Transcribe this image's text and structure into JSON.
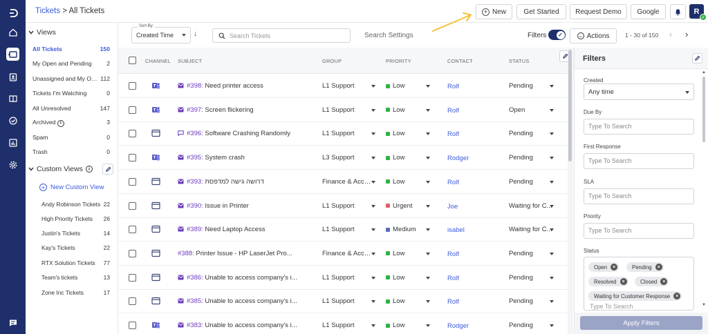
{
  "breadcrumb": {
    "parent": "Tickets",
    "separator": " > ",
    "current": "All Tickets"
  },
  "header_buttons": {
    "new": "New",
    "get_started": "Get Started",
    "request_demo": "Request Demo",
    "google": "Google"
  },
  "avatar": {
    "initial": "R",
    "status_color": "#2fb344"
  },
  "views": {
    "title": "Views",
    "items": [
      {
        "label": "All Tickets",
        "count": "150"
      },
      {
        "label": "My Open and Pending",
        "count": "2"
      },
      {
        "label": "Unassigned and My Op...",
        "count": "112"
      },
      {
        "label": "Tickets I'm Watching",
        "count": "0"
      },
      {
        "label": "All Unresolved",
        "count": "147"
      },
      {
        "label": "Archived",
        "count": "3"
      },
      {
        "label": "Spam",
        "count": "0"
      },
      {
        "label": "Trash",
        "count": "0"
      }
    ]
  },
  "custom_views": {
    "title": "Custom Views",
    "new_label": "New Custom View",
    "items": [
      {
        "label": "Andy Robinson Tickets",
        "count": "22"
      },
      {
        "label": "High Priority Tickets",
        "count": "26"
      },
      {
        "label": "Justin's Tickets",
        "count": "14"
      },
      {
        "label": "Kay's Tickets",
        "count": "22"
      },
      {
        "label": "RTX Solution Tickets",
        "count": "77"
      },
      {
        "label": "Team's tickets",
        "count": "13"
      },
      {
        "label": "Zone Inc Tickets",
        "count": "17"
      }
    ]
  },
  "toolbar": {
    "sort_label": "Sort By:",
    "sort_value": "Created Time",
    "search_placeholder": "Search Tickets",
    "search_settings": "Search Settings",
    "filters_label": "Filters",
    "actions_label": "Actions",
    "pagination": "1 - 30 of 150"
  },
  "table": {
    "columns": {
      "channel": "CHANNEL",
      "subject": "SUBJECT",
      "group": "GROUP",
      "priority": "PRIORITY",
      "contact": "CONTACT",
      "status": "STATUS"
    },
    "rows": [
      {
        "channel": "teams",
        "subject_icon": "email",
        "number": "#398:",
        "subject": "Need printer access",
        "group": "L1 Support",
        "priority": "Low",
        "contact": "Rolf",
        "status": "Pending"
      },
      {
        "channel": "teams",
        "subject_icon": "email",
        "number": "#397:",
        "subject": "Screen flickering",
        "group": "L1 Support",
        "priority": "Low",
        "contact": "Rolf",
        "status": "Open"
      },
      {
        "channel": "portal",
        "subject_icon": "chat",
        "number": "#396:",
        "subject": "Software Crashing Randomly",
        "group": "L1 Support",
        "priority": "Low",
        "contact": "Rolf",
        "status": "Pending"
      },
      {
        "channel": "teams",
        "subject_icon": "email",
        "number": "#395:",
        "subject": "System crash",
        "group": "L3 Support",
        "priority": "Low",
        "contact": "Rodger",
        "status": "Pending"
      },
      {
        "channel": "portal",
        "subject_icon": "email",
        "number": "#393:",
        "subject": "דרושה גישה למדפסת",
        "group": "Finance & Acco...",
        "priority": "Low",
        "contact": "Rolf",
        "status": "Pending"
      },
      {
        "channel": "portal",
        "subject_icon": "email",
        "number": "#390:",
        "subject": "Issue in Printer",
        "group": "L1 Support",
        "priority": "Urgent",
        "contact": "Joe",
        "status": "Waiting for C..."
      },
      {
        "channel": "portal",
        "subject_icon": "email",
        "number": "#389:",
        "subject": "Need Laptop Access",
        "group": "L1 Support",
        "priority": "Medium",
        "contact": "isabel",
        "status": "Waiting for C..."
      },
      {
        "channel": "portal",
        "subject_icon": "",
        "number": "#388:",
        "subject": "Printer Issue - HP LaserJet Pro...",
        "group": "Finance & Acco...",
        "priority": "Low",
        "contact": "Rolf",
        "status": "Pending"
      },
      {
        "channel": "portal",
        "subject_icon": "email",
        "number": "#386:",
        "subject": "Unable to access company's i...",
        "group": "L1 Support",
        "priority": "Low",
        "contact": "Rolf",
        "status": "Pending"
      },
      {
        "channel": "portal",
        "subject_icon": "email",
        "number": "#385:",
        "subject": "Unable to access company's i...",
        "group": "L1 Support",
        "priority": "Low",
        "contact": "Rolf",
        "status": "Pending"
      },
      {
        "channel": "teams",
        "subject_icon": "email",
        "number": "#383:",
        "subject": "Unable to access company's i...",
        "group": "L1 Support",
        "priority": "Low",
        "contact": "Rodger",
        "status": "Pending"
      }
    ]
  },
  "priority_colors": {
    "Low": "#2fb344",
    "Urgent": "#e35d6a",
    "Medium": "#5b6fb5"
  },
  "filters": {
    "title": "Filters",
    "created_label": "Created",
    "created_value": "Any time",
    "due_by_label": "Due By",
    "first_response_label": "First Response",
    "sla_label": "SLA",
    "priority_label": "Priority",
    "status_label": "Status",
    "search_placeholder": "Type To Search",
    "status_chips": [
      "Open",
      "Pending",
      "Resolved",
      "Closed",
      "Waiting for Customer Response"
    ],
    "apply_label": "Apply Filters"
  },
  "colors": {
    "brand": "#1f2f6b",
    "link": "#3b5bdb",
    "ticket_number": "#6c3bbf"
  }
}
